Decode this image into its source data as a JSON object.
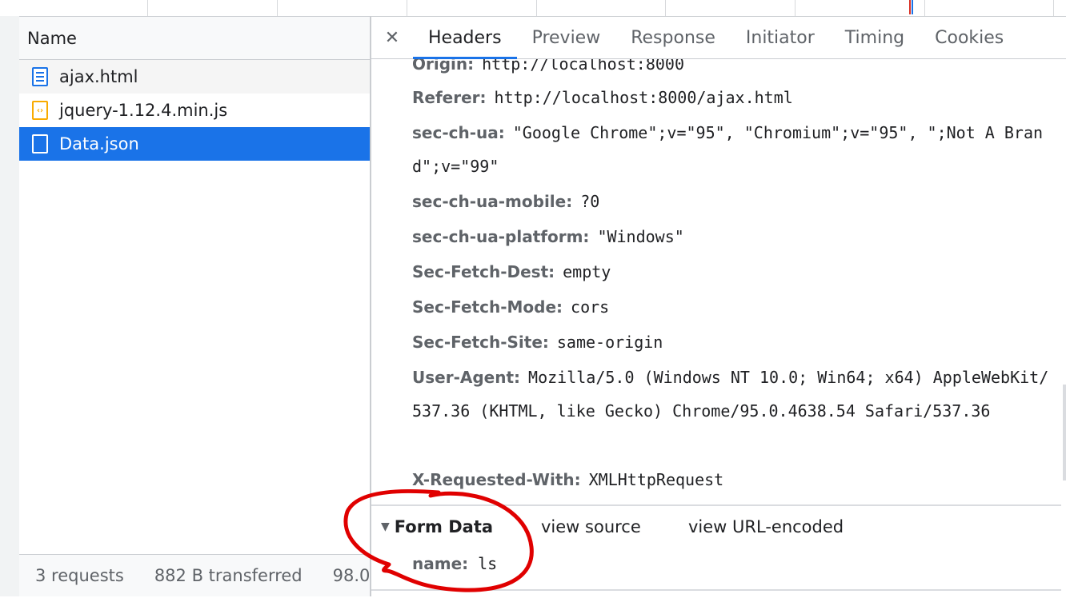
{
  "request_list": {
    "column_header": "Name",
    "items": [
      {
        "label": "ajax.html",
        "icon": "html-document-icon"
      },
      {
        "label": "jquery-1.12.4.min.js",
        "icon": "script-file-icon"
      },
      {
        "label": "Data.json",
        "icon": "json-file-icon",
        "selected": true
      }
    ]
  },
  "status_bar": {
    "requests": "3 requests",
    "transferred": "882 B transferred",
    "resources": "98.0"
  },
  "detail_tabs": {
    "close": "✕",
    "tabs": [
      "Headers",
      "Preview",
      "Response",
      "Initiator",
      "Timing",
      "Cookies"
    ],
    "active": "Headers"
  },
  "request_headers": [
    {
      "key": "Origin:",
      "value": "http://localhost:8000"
    },
    {
      "key": "Referer:",
      "value": "http://localhost:8000/ajax.html"
    },
    {
      "key": "sec-ch-ua:",
      "value": "\"Google Chrome\";v=\"95\", \"Chromium\";v=\"95\", \";Not A Brand\";v=\"99\""
    },
    {
      "key": "sec-ch-ua-mobile:",
      "value": "?0"
    },
    {
      "key": "sec-ch-ua-platform:",
      "value": "\"Windows\""
    },
    {
      "key": "Sec-Fetch-Dest:",
      "value": "empty"
    },
    {
      "key": "Sec-Fetch-Mode:",
      "value": "cors"
    },
    {
      "key": "Sec-Fetch-Site:",
      "value": "same-origin"
    },
    {
      "key": "User-Agent:",
      "value": "Mozilla/5.0 (Windows NT 10.0; Win64; x64) AppleWebKit/537.36 (KHTML, like Gecko) Chrome/95.0.4638.54 Safari/537.36"
    },
    {
      "key": "X-Requested-With:",
      "value": "XMLHttpRequest"
    }
  ],
  "form_data": {
    "title": "Form Data",
    "view_source": "view source",
    "view_url_encoded": "view URL-encoded",
    "fields": [
      {
        "key": "name:",
        "value": "ls"
      }
    ]
  },
  "colors": {
    "selected_row": "#1a73e8",
    "annotation": "#e00000",
    "header_key": "#5f6368"
  }
}
